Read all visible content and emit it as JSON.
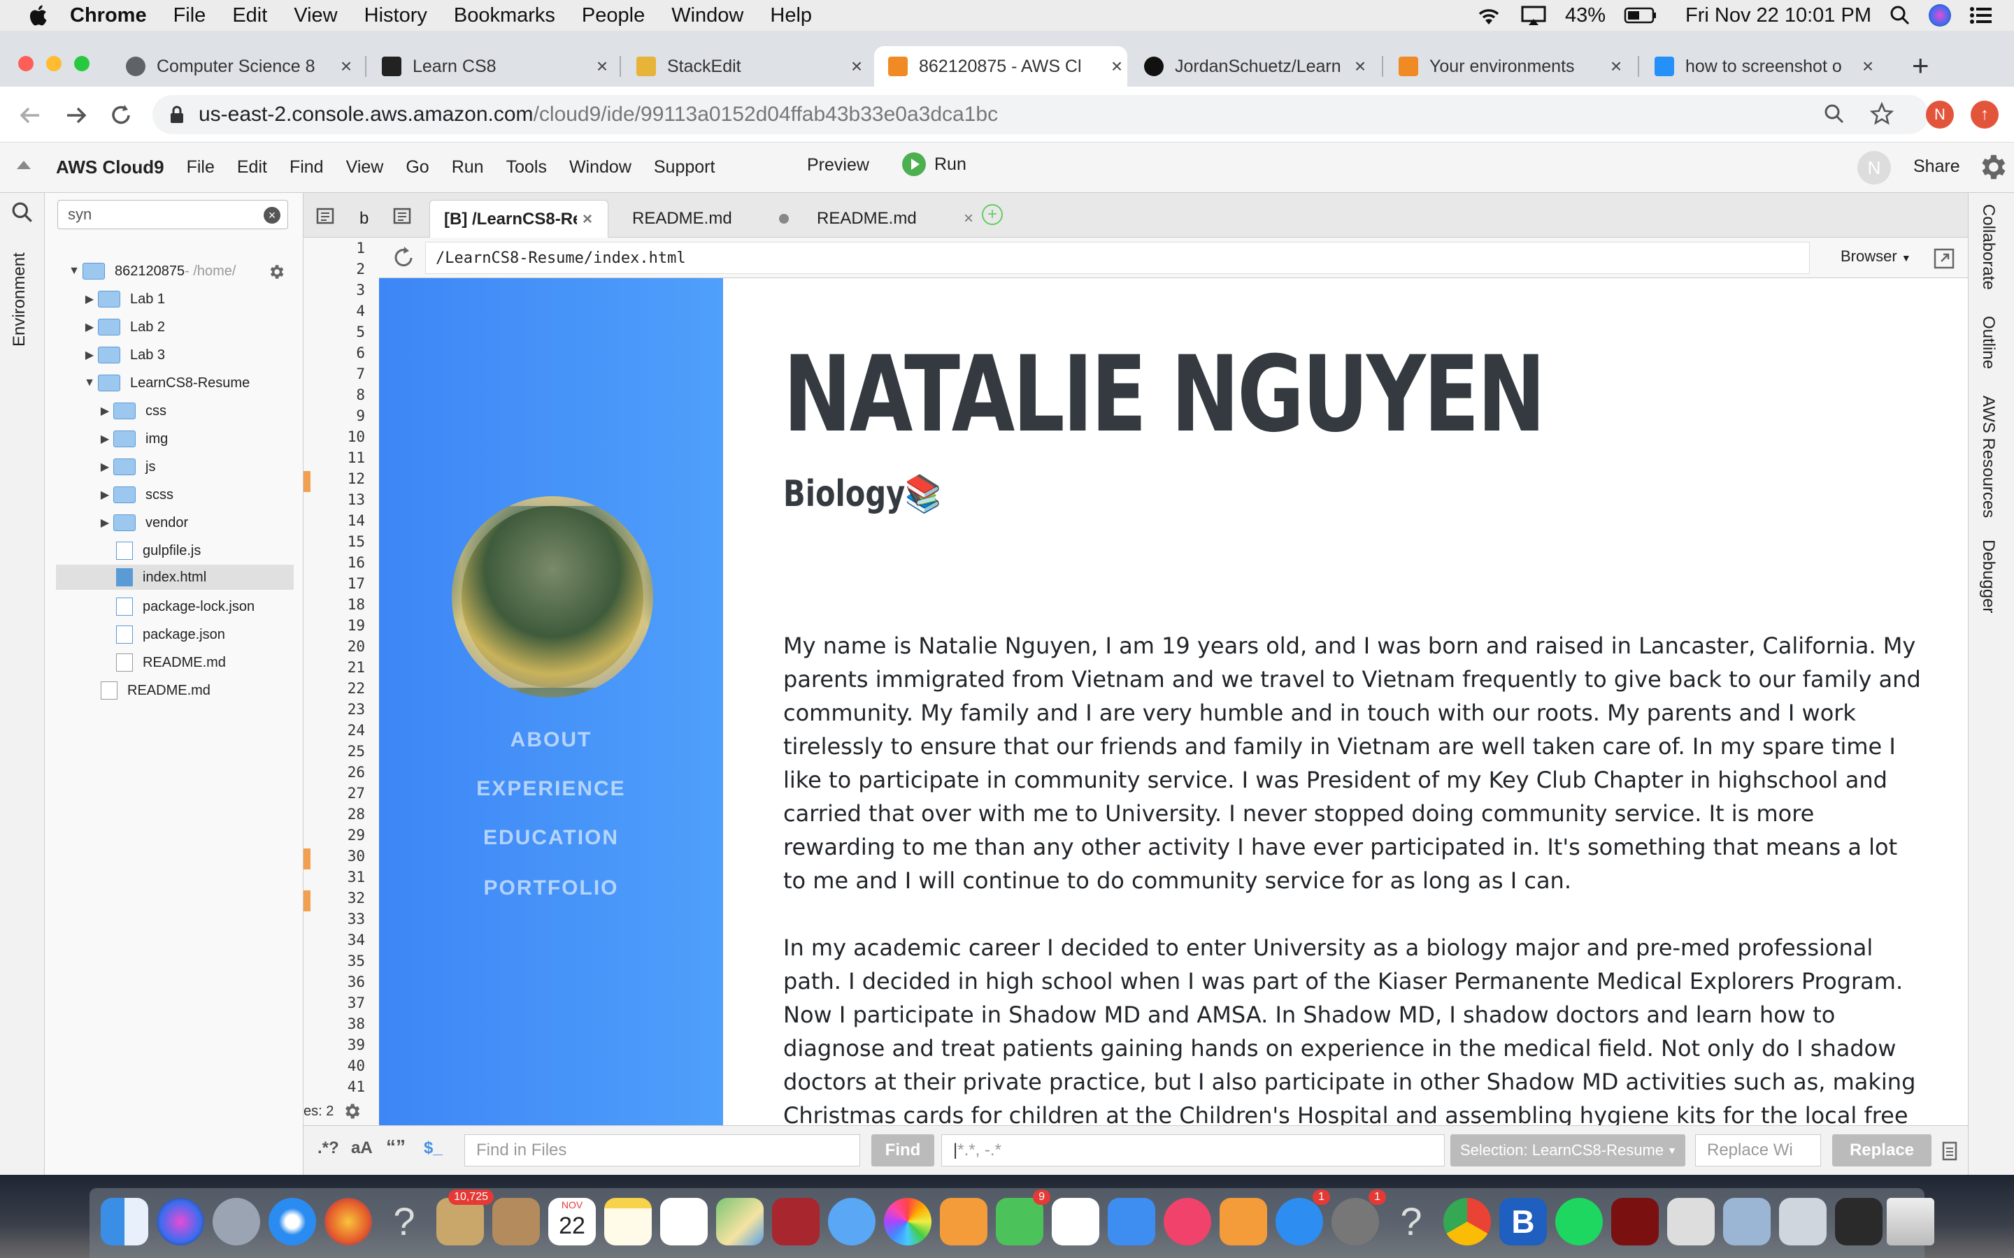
{
  "menubar": {
    "app": "Chrome",
    "items": [
      "File",
      "Edit",
      "View",
      "History",
      "Bookmarks",
      "People",
      "Window",
      "Help"
    ],
    "battery": "43%",
    "datetime": "Fri Nov 22  10:01 PM"
  },
  "tabs": [
    {
      "label": "Computer Science 8",
      "color": "#5f6368"
    },
    {
      "label": "Learn CS8",
      "color": "#222222"
    },
    {
      "label": "StackEdit",
      "color": "#e8b339"
    },
    {
      "label": "862120875 - AWS Cl",
      "color": "#f08a24"
    },
    {
      "label": "JordanSchuetz/Learn",
      "color": "#111111"
    },
    {
      "label": "Your environments",
      "color": "#f08a24"
    },
    {
      "label": "how to screenshot o",
      "color": "#258ffa"
    }
  ],
  "omnibox": {
    "host": "us-east-2.console.aws.amazon.com",
    "path": "/cloud9/ide/99113a0152d04ffab43b33e0a3dca1bc"
  },
  "profile_initial": "N",
  "c9menu": {
    "brand": "AWS Cloud9",
    "items": [
      "File",
      "Edit",
      "Find",
      "View",
      "Go",
      "Run",
      "Tools",
      "Window",
      "Support"
    ],
    "preview": "Preview",
    "run": "Run",
    "avatar": "N",
    "share": "Share"
  },
  "left_panel_label": "Environment",
  "tree": {
    "search": "syn",
    "root": "862120875",
    "root_path": " - /home/",
    "items": [
      "Lab 1",
      "Lab 2",
      "Lab 3",
      "LearnCS8-Resume",
      "css",
      "img",
      "js",
      "scss",
      "vendor",
      "gulpfile.js",
      "index.html",
      "package-lock.json",
      "package.json",
      "README.md",
      "README.md"
    ]
  },
  "editor_tabs": [
    "b",
    "[B] /LearnCS8-Re",
    "README.md",
    "README.md"
  ],
  "line_numbers": [
    "1",
    "2",
    "3",
    "4",
    "5",
    "6",
    "7",
    "8",
    "9",
    "10",
    "11",
    "12",
    "13",
    "14",
    "15",
    "16",
    "17",
    "18",
    "19",
    "20",
    "21",
    "22",
    "23",
    "24",
    "25",
    "26",
    "27",
    "28",
    "29",
    "30",
    "31",
    "32",
    "33",
    "34",
    "35",
    "36",
    "37",
    "38",
    "39",
    "40",
    "41"
  ],
  "gutter_footer": "es: 2",
  "preview": {
    "url": "/LearnCS8-Resume/index.html",
    "mode": "Browser",
    "nav": [
      "ABOUT",
      "EXPERIENCE",
      "EDUCATION",
      "PORTFOLIO"
    ],
    "name": "NATALIE NGUYEN",
    "major": "Biology📚",
    "paragraphs": [
      "My name is Natalie Nguyen, I am 19 years old, and I was born and raised in Lancaster, California. My parents immigrated from Vietnam and we travel to Vietnam frequently to give back to our family and community. My family and I are very humble and in touch with our roots. My parents and I work tirelessly to ensure that our friends and family in Vietnam are well taken care of. In my spare time I like to participate in community service. I was President of my Key Club Chapter in highschool and carried that over with me to University. I never stopped doing community service. It is more rewarding to me than any other activity I have ever participated in. It's something that means a lot to me and I will continue to do community service for as long as I can.",
      "In my academic career I decided to enter University as a biology major and pre-med professional path. I decided in high school when I was part of the Kiaser Permanente Medical Explorers Program. Now I participate in Shadow MD and AMSA. In Shadow MD, I shadow doctors and learn how to diagnose and treat patients gaining hands on experience in the medical field. Not only do I shadow doctors at their private practice, but I also participate in other Shadow MD activities such as, making Christmas cards for children at the Children's Hospital and assembling hygiene kits for the local free clinic. I also participate in AMSA and volunteer in health fairs and other activities for the community that include providing service"
    ]
  },
  "right_panel": [
    "Collaborate",
    "Outline",
    "AWS Resources",
    "Debugger"
  ],
  "findbar": {
    "regex": ".*?",
    "case": "aA",
    "word": "“”",
    "find_placeholder": "Find in Files",
    "find_btn": "Find",
    "pattern_placeholder": "*.*, -.*",
    "selection": "Selection: LearnCS8-Resume",
    "replace_placeholder": "Replace Wi",
    "replace_btn": "Replace"
  },
  "dock": {
    "badges": [
      "10,725",
      "9",
      "1",
      "1"
    ],
    "calendar_month": "NOV",
    "calendar_day": "22"
  }
}
